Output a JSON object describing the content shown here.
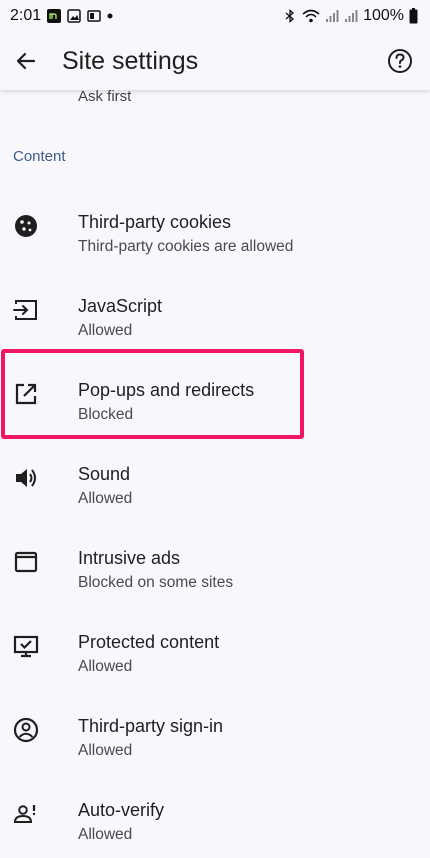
{
  "status_bar": {
    "time": "2:01",
    "battery": "100%"
  },
  "app_bar": {
    "title": "Site settings"
  },
  "partial_row": {
    "subtitle": "Ask first"
  },
  "section": {
    "header": "Content"
  },
  "rows": [
    {
      "label": "Third-party cookies",
      "sub": "Third-party cookies are allowed",
      "icon": "cookie-icon"
    },
    {
      "label": "JavaScript",
      "sub": "Allowed",
      "icon": "javascript-icon"
    },
    {
      "label": "Pop-ups and redirects",
      "sub": "Blocked",
      "icon": "open-in-new-icon"
    },
    {
      "label": "Sound",
      "sub": "Allowed",
      "icon": "volume-icon"
    },
    {
      "label": "Intrusive ads",
      "sub": "Blocked on some sites",
      "icon": "window-icon"
    },
    {
      "label": "Protected content",
      "sub": "Allowed",
      "icon": "monitor-check-icon"
    },
    {
      "label": "Third-party sign-in",
      "sub": "Allowed",
      "icon": "account-circle-icon"
    },
    {
      "label": "Auto-verify",
      "sub": "Allowed",
      "icon": "person-alert-icon"
    }
  ],
  "colors": {
    "accent_highlight": "#f01667",
    "section_header": "#3b5d86",
    "background": "#f8f7fc"
  }
}
